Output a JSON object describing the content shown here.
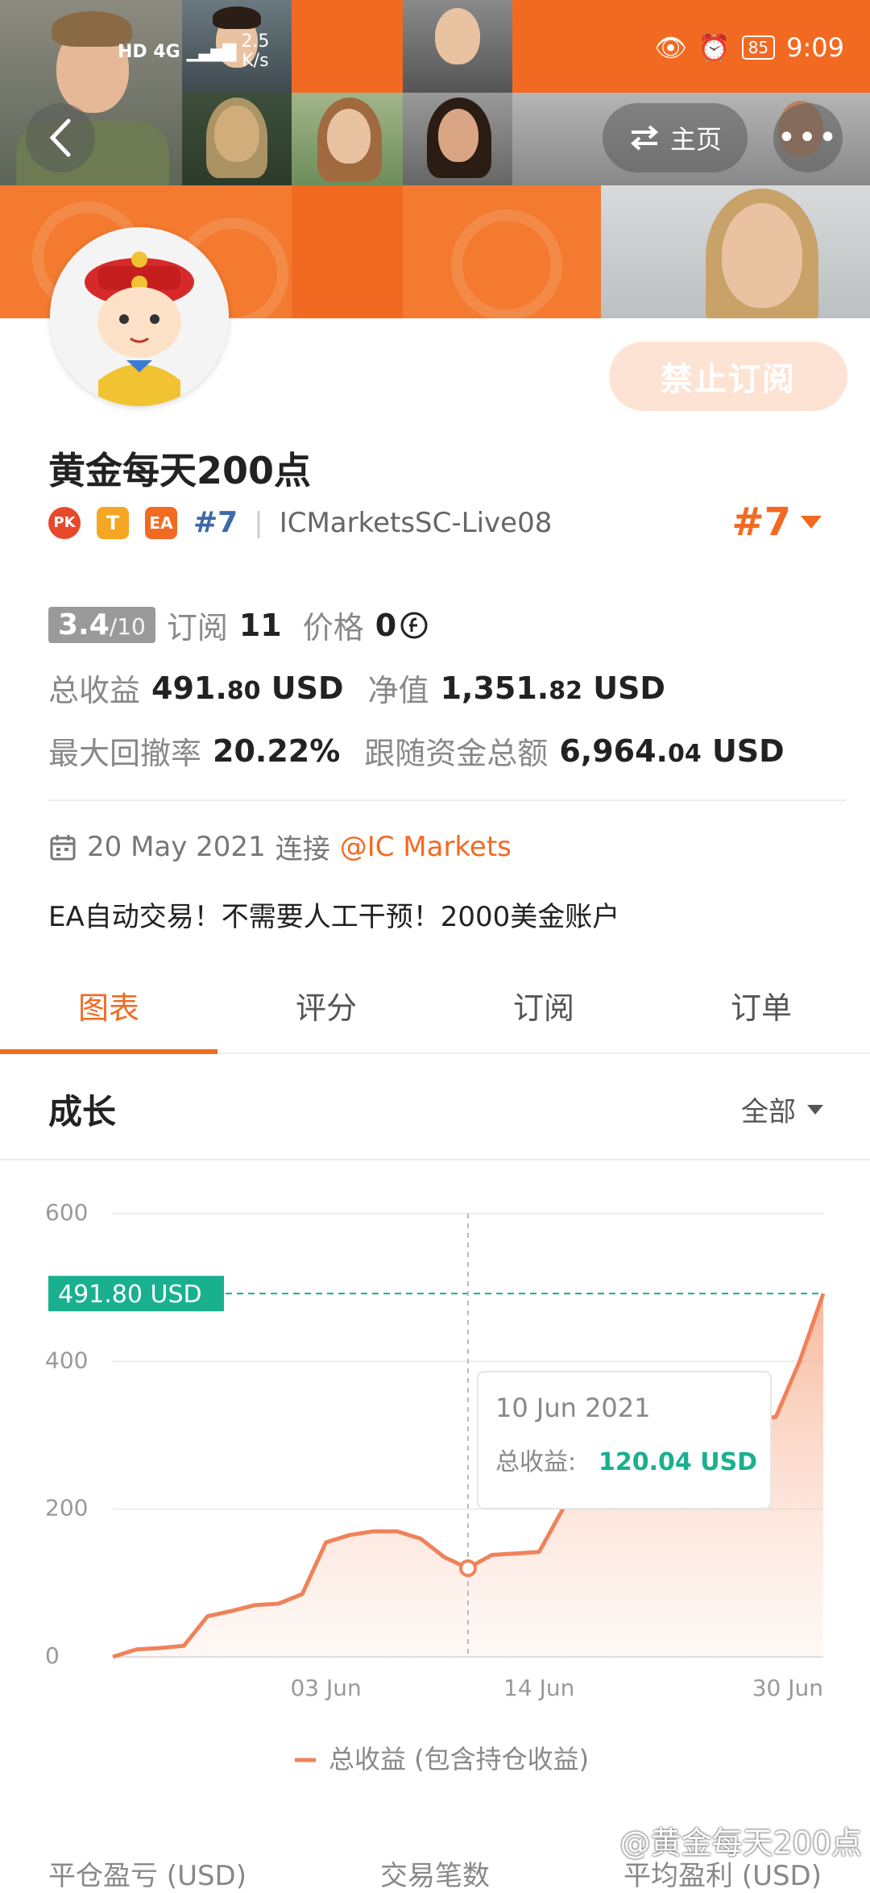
{
  "status_bar": {
    "network": "HD 4G",
    "speed_value": "2.5",
    "speed_unit": "K/s",
    "battery": "85",
    "time": "9:09"
  },
  "header": {
    "home_label": "主页",
    "more_label": "•••",
    "subscribe_label": "禁止订阅"
  },
  "profile": {
    "name": "黄金每天200点",
    "badges": [
      "PK",
      "T",
      "EA"
    ],
    "rank_small": "#7",
    "account": "ICMarketsSC-Live08",
    "rank": "#7"
  },
  "stats": {
    "score": "3.4",
    "score_max": "/10",
    "subscribe_label": "订阅",
    "subscribe_count": "11",
    "price_label": "价格",
    "price_value": "0",
    "total_profit_label": "总收益",
    "total_profit_main": "491.",
    "total_profit_dec": "80",
    "total_profit_unit": "USD",
    "equity_label": "净值",
    "equity_main": "1,351.",
    "equity_dec": "82",
    "equity_unit": "USD",
    "drawdown_label": "最大回撤率",
    "drawdown_value": "20.22%",
    "follow_label": "跟随资金总额",
    "follow_main": "6,964.",
    "follow_dec": "04",
    "follow_unit": "USD"
  },
  "connection": {
    "date": "20 May 2021",
    "connect_label": "连接",
    "broker": "@IC Markets"
  },
  "description": "EA自动交易！不需要人工干预！2000美金账户",
  "tabs": [
    "图表",
    "评分",
    "订阅",
    "订单"
  ],
  "section": {
    "title": "成长",
    "filter": "全部"
  },
  "chart_data": {
    "type": "area",
    "series": [
      {
        "name": "总收益 (包含持仓收益)",
        "x": [
          "24 May",
          "25 May",
          "26 May",
          "27 May",
          "28 May",
          "29 May",
          "31 May",
          "01 Jun",
          "02 Jun",
          "03 Jun",
          "04 Jun",
          "05 Jun",
          "07 Jun",
          "08 Jun",
          "09 Jun",
          "10 Jun",
          "11 Jun",
          "12 Jun",
          "14 Jun",
          "15 Jun",
          "16 Jun",
          "17 Jun",
          "18 Jun",
          "21 Jun",
          "22 Jun",
          "23 Jun",
          "24 Jun",
          "25 Jun",
          "28 Jun",
          "29 Jun",
          "30 Jun"
        ],
        "values": [
          0,
          10,
          12,
          15,
          55,
          62,
          70,
          72,
          85,
          155,
          165,
          170,
          170,
          160,
          135,
          120,
          138,
          140,
          142,
          200,
          240,
          270,
          290,
          300,
          310,
          315,
          318,
          320,
          325,
          400,
          491.8
        ]
      }
    ],
    "xticks": [
      "03 Jun",
      "14 Jun",
      "30 Jun"
    ],
    "yticks": [
      0,
      200,
      400,
      600
    ],
    "ylim": [
      0,
      600
    ],
    "current_label": "491.80 USD",
    "current_value": 491.8,
    "tooltip": {
      "date": "10 Jun 2021",
      "label": "总收益:",
      "value": "120.04 USD",
      "index": 15
    },
    "legend": "总收益 (包含持仓收益)",
    "accent": "#f26a22",
    "line_color": "#f0825a",
    "teal": "#19b08f"
  },
  "bottom_labels": [
    "平仓盈亏 (USD)",
    "交易笔数",
    "平均盈利 (USD)"
  ],
  "watermark": "@黄金每天200点"
}
